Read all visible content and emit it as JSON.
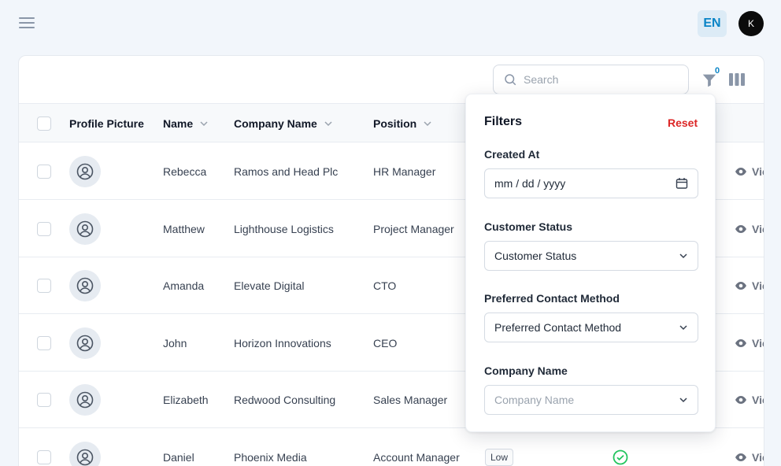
{
  "header": {
    "language": "EN",
    "user_initial": "K"
  },
  "toolbar": {
    "search_placeholder": "Search",
    "filter_count": "0"
  },
  "table": {
    "columns": [
      "Profile Picture",
      "Name",
      "Company Name",
      "Position"
    ],
    "rows": [
      {
        "name": "Rebecca",
        "company": "Ramos and Head Plc",
        "position": "HR Manager",
        "action": "Vie"
      },
      {
        "name": "Matthew",
        "company": "Lighthouse Logistics",
        "position": "Project Manager",
        "action": "Vie"
      },
      {
        "name": "Amanda",
        "company": "Elevate Digital",
        "position": "CTO",
        "action": "Vie"
      },
      {
        "name": "John",
        "company": "Horizon Innovations",
        "position": "CEO",
        "action": "Vie"
      },
      {
        "name": "Elizabeth",
        "company": "Redwood Consulting",
        "position": "Sales Manager",
        "action": "Vie"
      },
      {
        "name": "Daniel",
        "company": "Phoenix Media",
        "position": "Account Manager",
        "priority": "Low",
        "action": "Vie"
      }
    ]
  },
  "filters": {
    "title": "Filters",
    "reset": "Reset",
    "created_at_label": "Created At",
    "created_at_placeholder": "mm / dd / yyyy",
    "customer_status_label": "Customer Status",
    "customer_status_value": "Customer Status",
    "preferred_contact_label": "Preferred Contact Method",
    "preferred_contact_value": "Preferred Contact Method",
    "company_name_label": "Company Name",
    "company_name_placeholder": "Company Name"
  },
  "colors": {
    "accent": "#0a84c6",
    "reset": "#dc2626",
    "status_ok": "#22c55e"
  }
}
